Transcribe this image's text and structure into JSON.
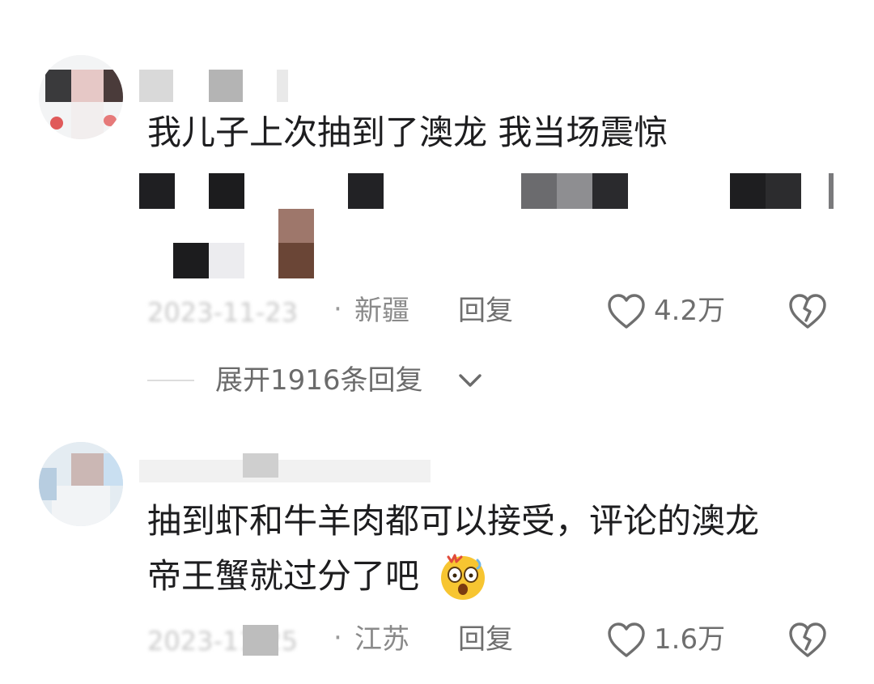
{
  "comments": [
    {
      "text_lines": [
        "我儿子上次抽到了澳龙 我当场震惊"
      ],
      "location": "新疆",
      "reply_label": "回复",
      "like_count": "4.2万",
      "expand": {
        "label": "展开1916条回复"
      }
    },
    {
      "text_lines": [
        "抽到虾和牛羊肉都可以接受，评论的澳龙",
        "帝王蟹就过分了吧"
      ],
      "location": "江苏",
      "reply_label": "回复",
      "like_count": "1.6万"
    }
  ],
  "icons": {
    "like": "heart-outline-icon",
    "dislike": "broken-heart-icon",
    "expand": "chevron-down-icon",
    "emoji": "shocked-face-emoji"
  },
  "colors": {
    "text_primary": "#1d1d1f",
    "text_secondary": "#6f6f6f",
    "text_location": "#8a8a8a",
    "icon_gray": "#6f6f6f"
  }
}
